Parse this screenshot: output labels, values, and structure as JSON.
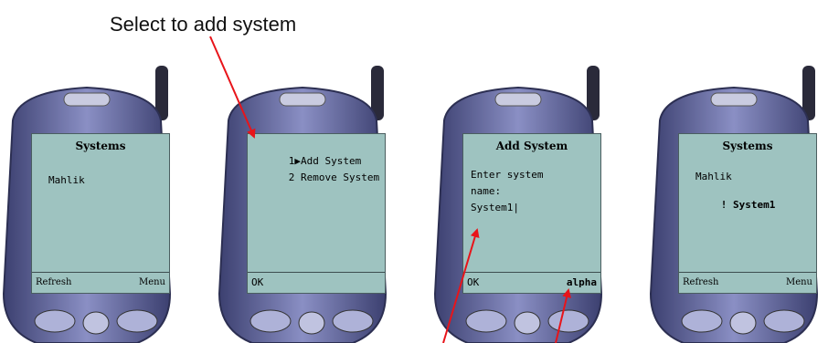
{
  "caption": "Select to add system",
  "phones": [
    {
      "title": "Systems",
      "lines": [
        "Mahlik"
      ],
      "soft_left": "Refresh",
      "soft_right": "Menu"
    },
    {
      "menu": [
        {
          "num": "1",
          "label": "Add System"
        },
        {
          "num": "2",
          "label": "Remove System"
        }
      ],
      "soft_left": "OK"
    },
    {
      "title": "Add System",
      "lines": [
        "Enter system",
        "name:",
        "System1|"
      ],
      "soft_left": "OK",
      "soft_right": "alpha"
    },
    {
      "title": "Systems",
      "lines": [
        "Mahlik"
      ],
      "new_item_marker": "!",
      "new_item": "System1",
      "soft_left": "Refresh",
      "soft_right": "Menu"
    }
  ],
  "colors": {
    "screen": "#9ec3c0",
    "bezel": "#5a5f92",
    "arrow": "#e8141a"
  }
}
